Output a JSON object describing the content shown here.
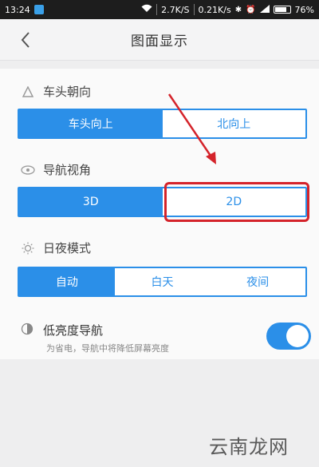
{
  "status_bar": {
    "time": "13:24",
    "speed_1": "2.7K/S",
    "speed_2": "0.21K/s",
    "battery": "76%"
  },
  "header": {
    "title": "图面显示"
  },
  "sections": {
    "heading_direction": {
      "label": "车头朝向",
      "options": [
        "车头向上",
        "北向上"
      ],
      "selected_index": 0
    },
    "nav_view": {
      "label": "导航视角",
      "options": [
        "3D",
        "2D"
      ],
      "selected_index": 0
    },
    "day_night": {
      "label": "日夜模式",
      "options": [
        "自动",
        "白天",
        "夜间"
      ],
      "selected_index": 0
    },
    "low_brightness": {
      "label": "低亮度导航",
      "subtitle": "为省电，导航中将降低屏幕亮度",
      "enabled": true
    }
  },
  "watermark": "云南龙网",
  "colors": {
    "accent": "#2b8fe8",
    "annotation": "#d4232a",
    "statusbar": "#1d1d1d"
  }
}
